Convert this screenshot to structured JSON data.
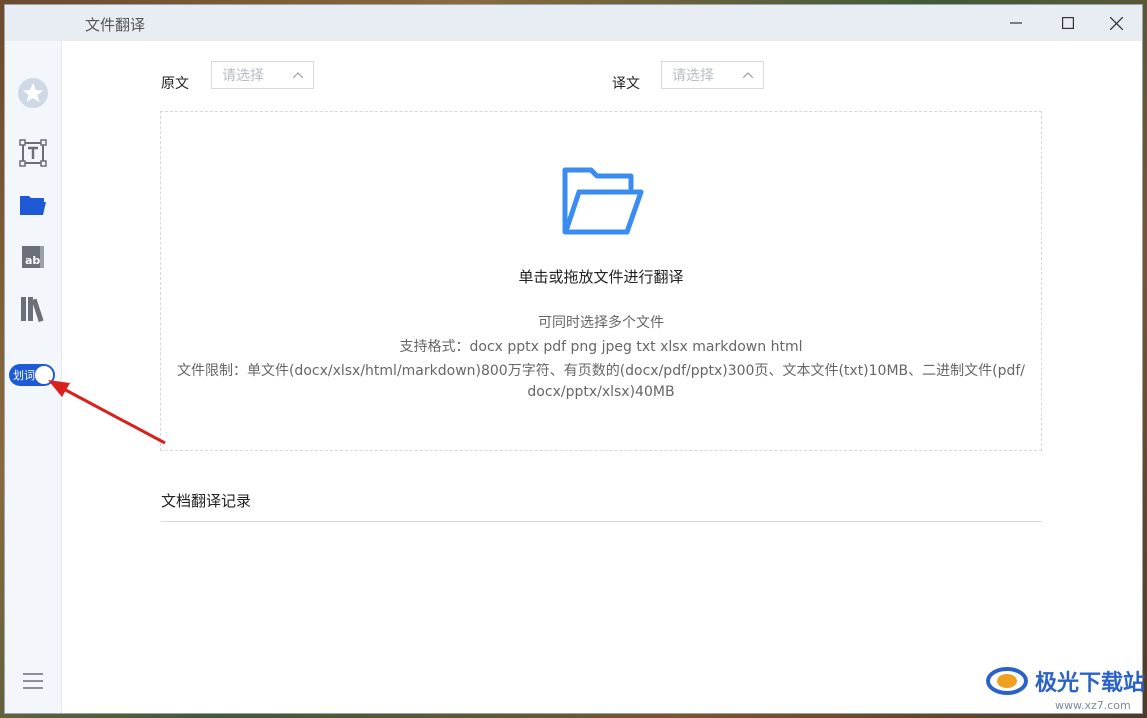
{
  "window": {
    "title": "文件翻译",
    "controls": [
      "minimize-icon",
      "maximize-icon",
      "close-icon"
    ]
  },
  "sidebar": {
    "items": [
      {
        "icon": "star-badge-icon"
      },
      {
        "icon": "text-translate-icon"
      },
      {
        "icon": "folder-open-icon",
        "active": true
      },
      {
        "icon": "image-text-icon"
      },
      {
        "icon": "library-books-icon"
      }
    ],
    "toggle_label": "划词",
    "toggle_on": true,
    "menu_icon": "hamburger-menu-icon"
  },
  "languages": {
    "source_label": "原文",
    "source_placeholder": "请选择",
    "target_label": "译文",
    "target_placeholder": "请选择"
  },
  "dropzone": {
    "main_text": "单击或拖放文件进行翻译",
    "line1": "可同时选择多个文件",
    "line2": "支持格式：docx pptx pdf png jpeg txt xlsx markdown html",
    "line3": "文件限制：单文件(docx/xlsx/html/markdown)800万字符、有页数的(docx/pdf/pptx)300页、文本文件(txt)10MB、二进制文件(pdf/",
    "line4": "docx/pptx/xlsx)40MB"
  },
  "records": {
    "title": "文档翻译记录"
  },
  "watermark": {
    "text": "极光下载站",
    "sub": "www.xz7.com"
  },
  "colors": {
    "accent": "#1f5ad6",
    "folder_blue": "#3b8cf0",
    "arrow_red": "#d9201c"
  }
}
